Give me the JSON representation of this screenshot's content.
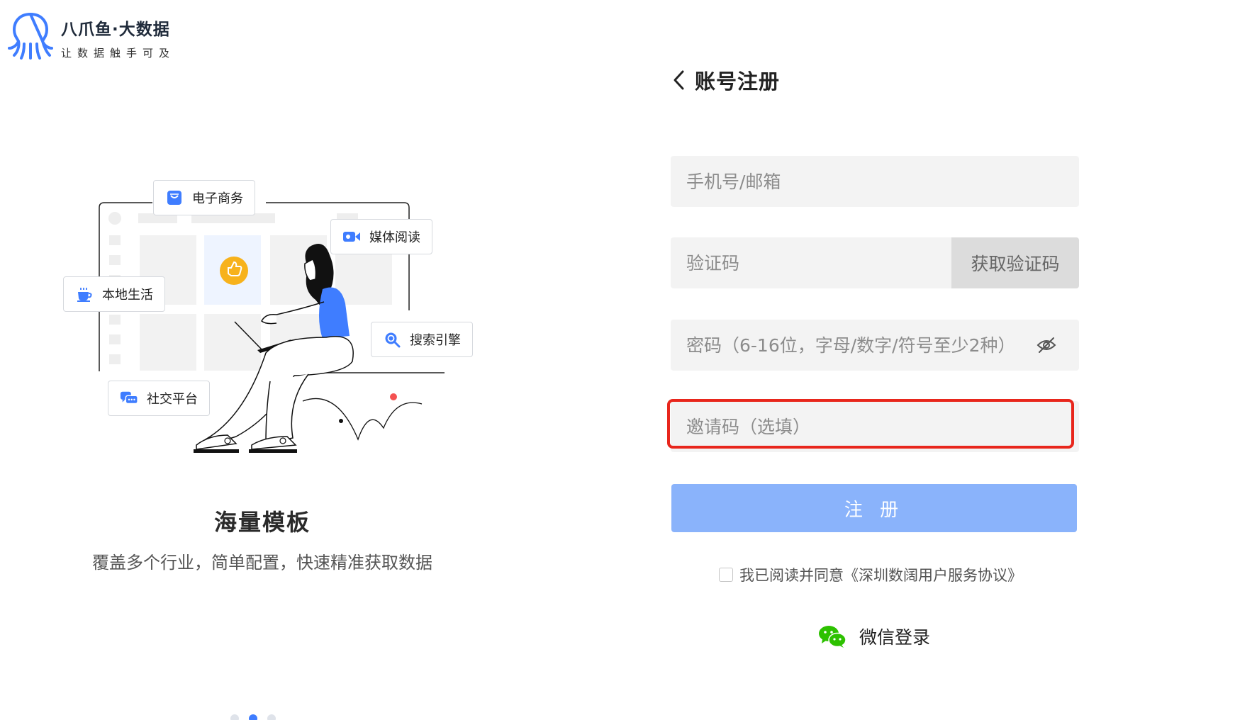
{
  "logo": {
    "name": "八爪鱼·大数据",
    "slogan": "让数据触手可及"
  },
  "illustration": {
    "chips": {
      "ecommerce": "电子商务",
      "media": "媒体阅读",
      "local": "本地生活",
      "search": "搜索引擎",
      "social": "社交平台"
    }
  },
  "carousel": {
    "title": "海量模板",
    "subtitle": "覆盖多个行业，简单配置，快速精准获取数据",
    "active_index": 1
  },
  "form": {
    "title": "账号注册",
    "phone_placeholder": "手机号/邮箱",
    "code_placeholder": "验证码",
    "get_code_label": "获取验证码",
    "password_placeholder": "密码（6-16位，字母/数字/符号至少2种）",
    "invite_placeholder": "邀请码（选填）",
    "register_label": "注 册",
    "agreement": "我已阅读并同意《深圳数阔用户服务协议》",
    "wechat_label": "微信登录"
  },
  "colors": {
    "primary": "#3f7dff",
    "button_disabled": "#8ab3fb",
    "highlight": "#e8261c",
    "wechat": "#2dc100"
  }
}
